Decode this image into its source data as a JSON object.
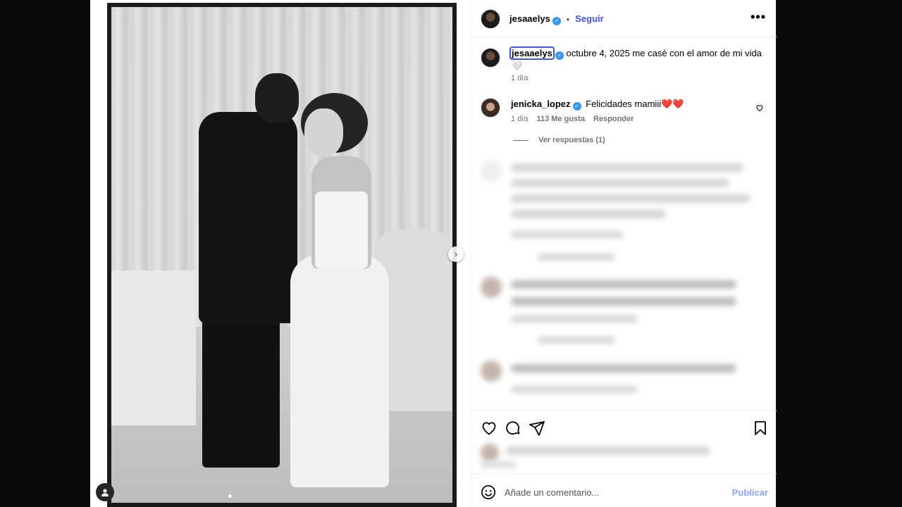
{
  "post": {
    "author": "jesaaelys",
    "follow_label": "Seguir",
    "separator": "•",
    "more_label": "•••",
    "caption": "octubre 4, 2025 me casé con el amor de mi vida",
    "caption_emoji": "🤍",
    "caption_time": "1 día"
  },
  "comment": {
    "author": "jenicka_lopez",
    "text": "Felicidades mamiii❤️❤️",
    "time": "1 día",
    "likes": "113 Me gusta",
    "reply_label": "Responder",
    "view_replies": "Ver respuestas (1)"
  },
  "media": {
    "next_label": "›",
    "dot_count": 15,
    "active_dot": 0
  },
  "composer": {
    "placeholder": "Añade un comentario...",
    "publish_label": "Publicar"
  },
  "icons": [
    "heart-icon",
    "comment-icon",
    "share-icon",
    "bookmark-icon",
    "emoji-icon",
    "user-tag-icon",
    "verified-icon",
    "more-icon",
    "chevron-right-icon"
  ],
  "colors": {
    "accent": "#4150f7",
    "verified": "#3897f0",
    "muted": "#737373",
    "publish": "#8ea5f7"
  }
}
